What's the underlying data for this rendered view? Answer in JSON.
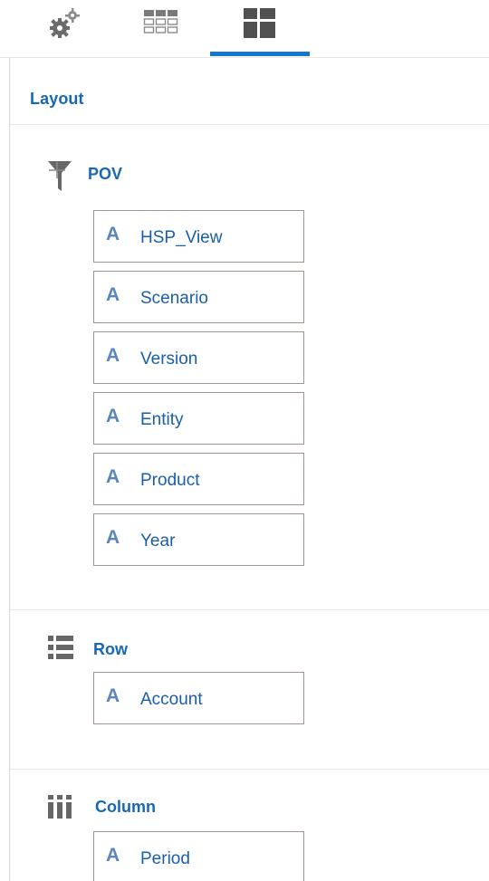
{
  "tabs": [
    {
      "name": "settings",
      "icon": "gears-icon",
      "selected": false
    },
    {
      "name": "grid",
      "icon": "grid-icon",
      "selected": false
    },
    {
      "name": "layout",
      "icon": "layout-icon",
      "selected": true
    }
  ],
  "layout": {
    "title": "Layout",
    "pov": {
      "label": "POV",
      "icon": "filter-icon",
      "add_icon": "plus-icon",
      "items": [
        "HSP_View",
        "Scenario",
        "Version",
        "Entity",
        "Product",
        "Year"
      ]
    },
    "row": {
      "label": "Row",
      "icon": "list-icon",
      "items": [
        "Account"
      ]
    },
    "column": {
      "label": "Column",
      "icon": "columns-icon",
      "items": [
        "Period"
      ]
    }
  },
  "dimension_icon_glyph": "A",
  "colors": {
    "accent": "#1778c9",
    "section_text": "#1868b0",
    "item_text": "#1a5ea8",
    "item_glyph": "#5a86c0",
    "item_border": "#a09490",
    "icon_gray": "#6b6b6b"
  }
}
